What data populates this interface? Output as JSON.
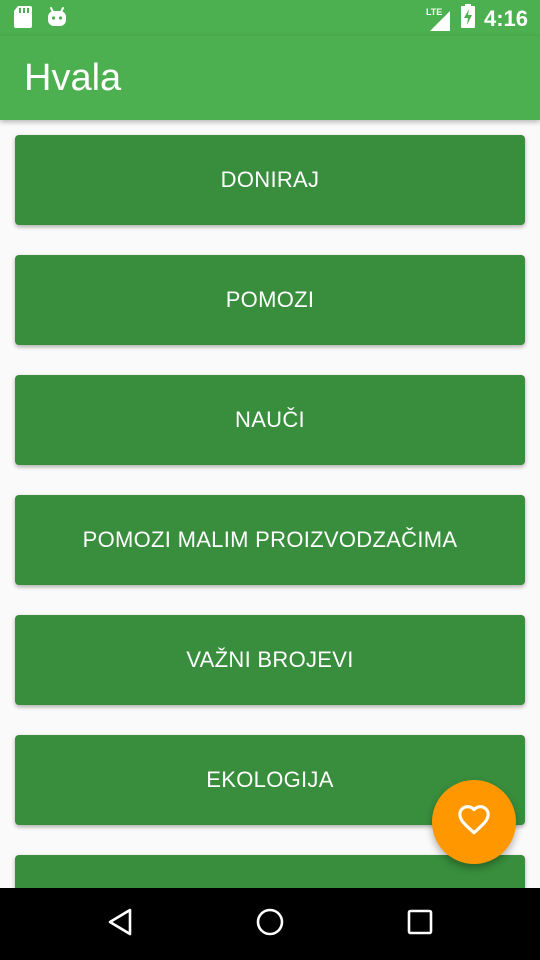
{
  "status_bar": {
    "time": "4:16",
    "network": "LTE",
    "icons": [
      "sd-card-icon",
      "android-icon",
      "signal-icon",
      "battery-charging-icon"
    ]
  },
  "app_bar": {
    "title": "Hvala"
  },
  "buttons": [
    {
      "label": "DONIRAJ"
    },
    {
      "label": "POMOZI"
    },
    {
      "label": "NAUČI"
    },
    {
      "label": "POMOZI MALIM PROIZVODZAČIMA"
    },
    {
      "label": "VAŽNI BROJEVI"
    },
    {
      "label": "EKOLOGIJA"
    },
    {
      "label": ""
    }
  ],
  "fab": {
    "icon": "heart-icon"
  },
  "navigation_bar": {
    "icons": [
      "back-icon",
      "home-icon",
      "recents-icon"
    ]
  },
  "colors": {
    "primary": "#4CAF50",
    "button": "#388E3C",
    "accent": "#FF9800",
    "background": "#FAFAFA"
  }
}
